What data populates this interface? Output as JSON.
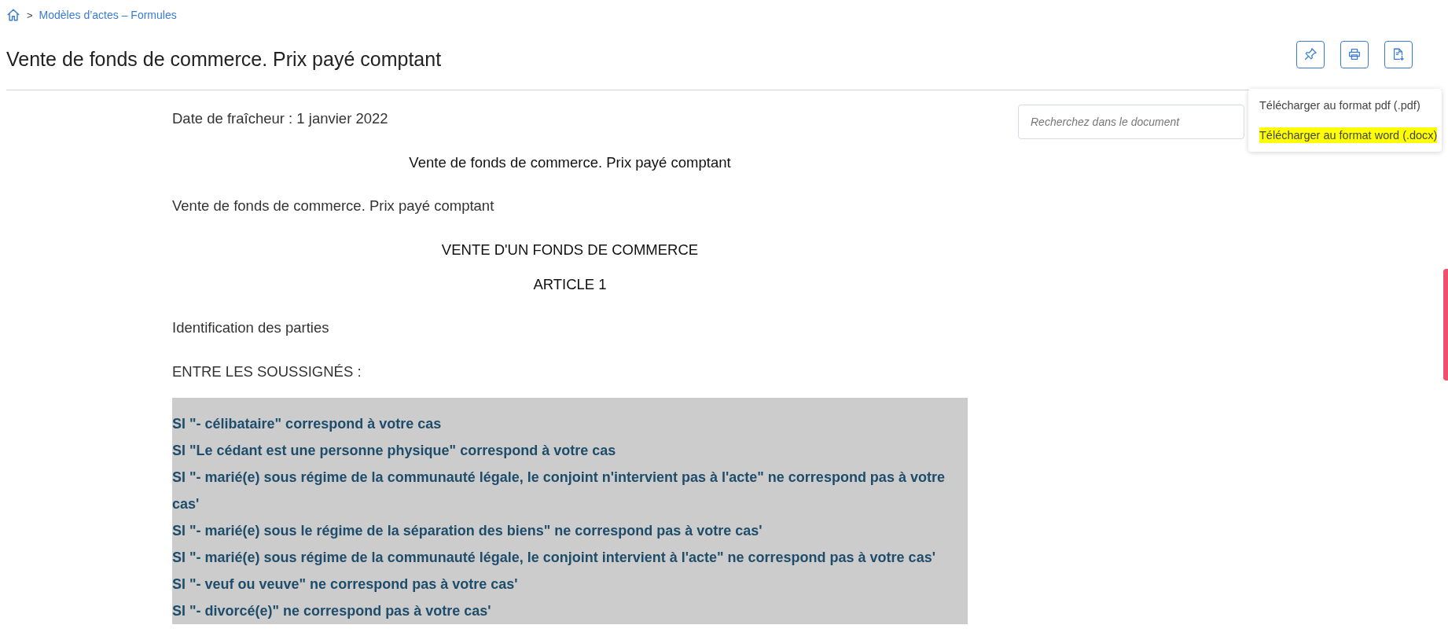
{
  "breadcrumb": {
    "separator": ">",
    "items": [
      "Modèles d’actes – Formules"
    ]
  },
  "title": "Vente de fonds de commerce. Prix payé comptant",
  "toolbar": [
    {
      "kind": "pin"
    },
    {
      "kind": "print"
    },
    {
      "kind": "download"
    }
  ],
  "download_menu": {
    "items": [
      {
        "label": "Télécharger au format pdf (.pdf)",
        "highlighted": false
      },
      {
        "label": "Télécharger au format word (.docx)",
        "highlighted": true
      }
    ]
  },
  "search": {
    "placeholder": "Recherchez dans le document"
  },
  "document": {
    "paragraphs": [
      {
        "kind": "plain",
        "text": "Date de fraîcheur : 1 janvier 2022"
      },
      {
        "kind": "center",
        "text": "Vente de fonds de commerce. Prix payé comptant"
      },
      {
        "kind": "plain",
        "text": "Vente de fonds de commerce. Prix payé comptant"
      },
      {
        "kind": "center",
        "text": "VENTE D'UN FONDS DE COMMERCE"
      },
      {
        "kind": "center-tight",
        "text": "ARTICLE 1"
      },
      {
        "kind": "plain",
        "text": "Identification des parties"
      },
      {
        "kind": "plain",
        "text": "ENTRE LES SOUSSIGNÉS :"
      }
    ],
    "conditions": [
      "SI \"- célibataire\" correspond à votre cas",
      "SI \"Le cédant est une personne physique\" correspond à votre cas",
      "SI \"- marié(e) sous régime de la communauté légale, le conjoint n'intervient pas à l'acte\" ne correspond pas à votre cas'",
      "SI \"- marié(e) sous le régime de la séparation des biens\" ne correspond pas à votre cas'",
      "SI \"- marié(e) sous régime de la communauté légale, le conjoint intervient à l'acte\" ne correspond pas à votre cas'",
      "SI \"- veuf ou veuve\" ne correspond pas à votre cas'",
      "SI \"- divorcé(e)\" ne correspond pas à votre cas'"
    ]
  }
}
